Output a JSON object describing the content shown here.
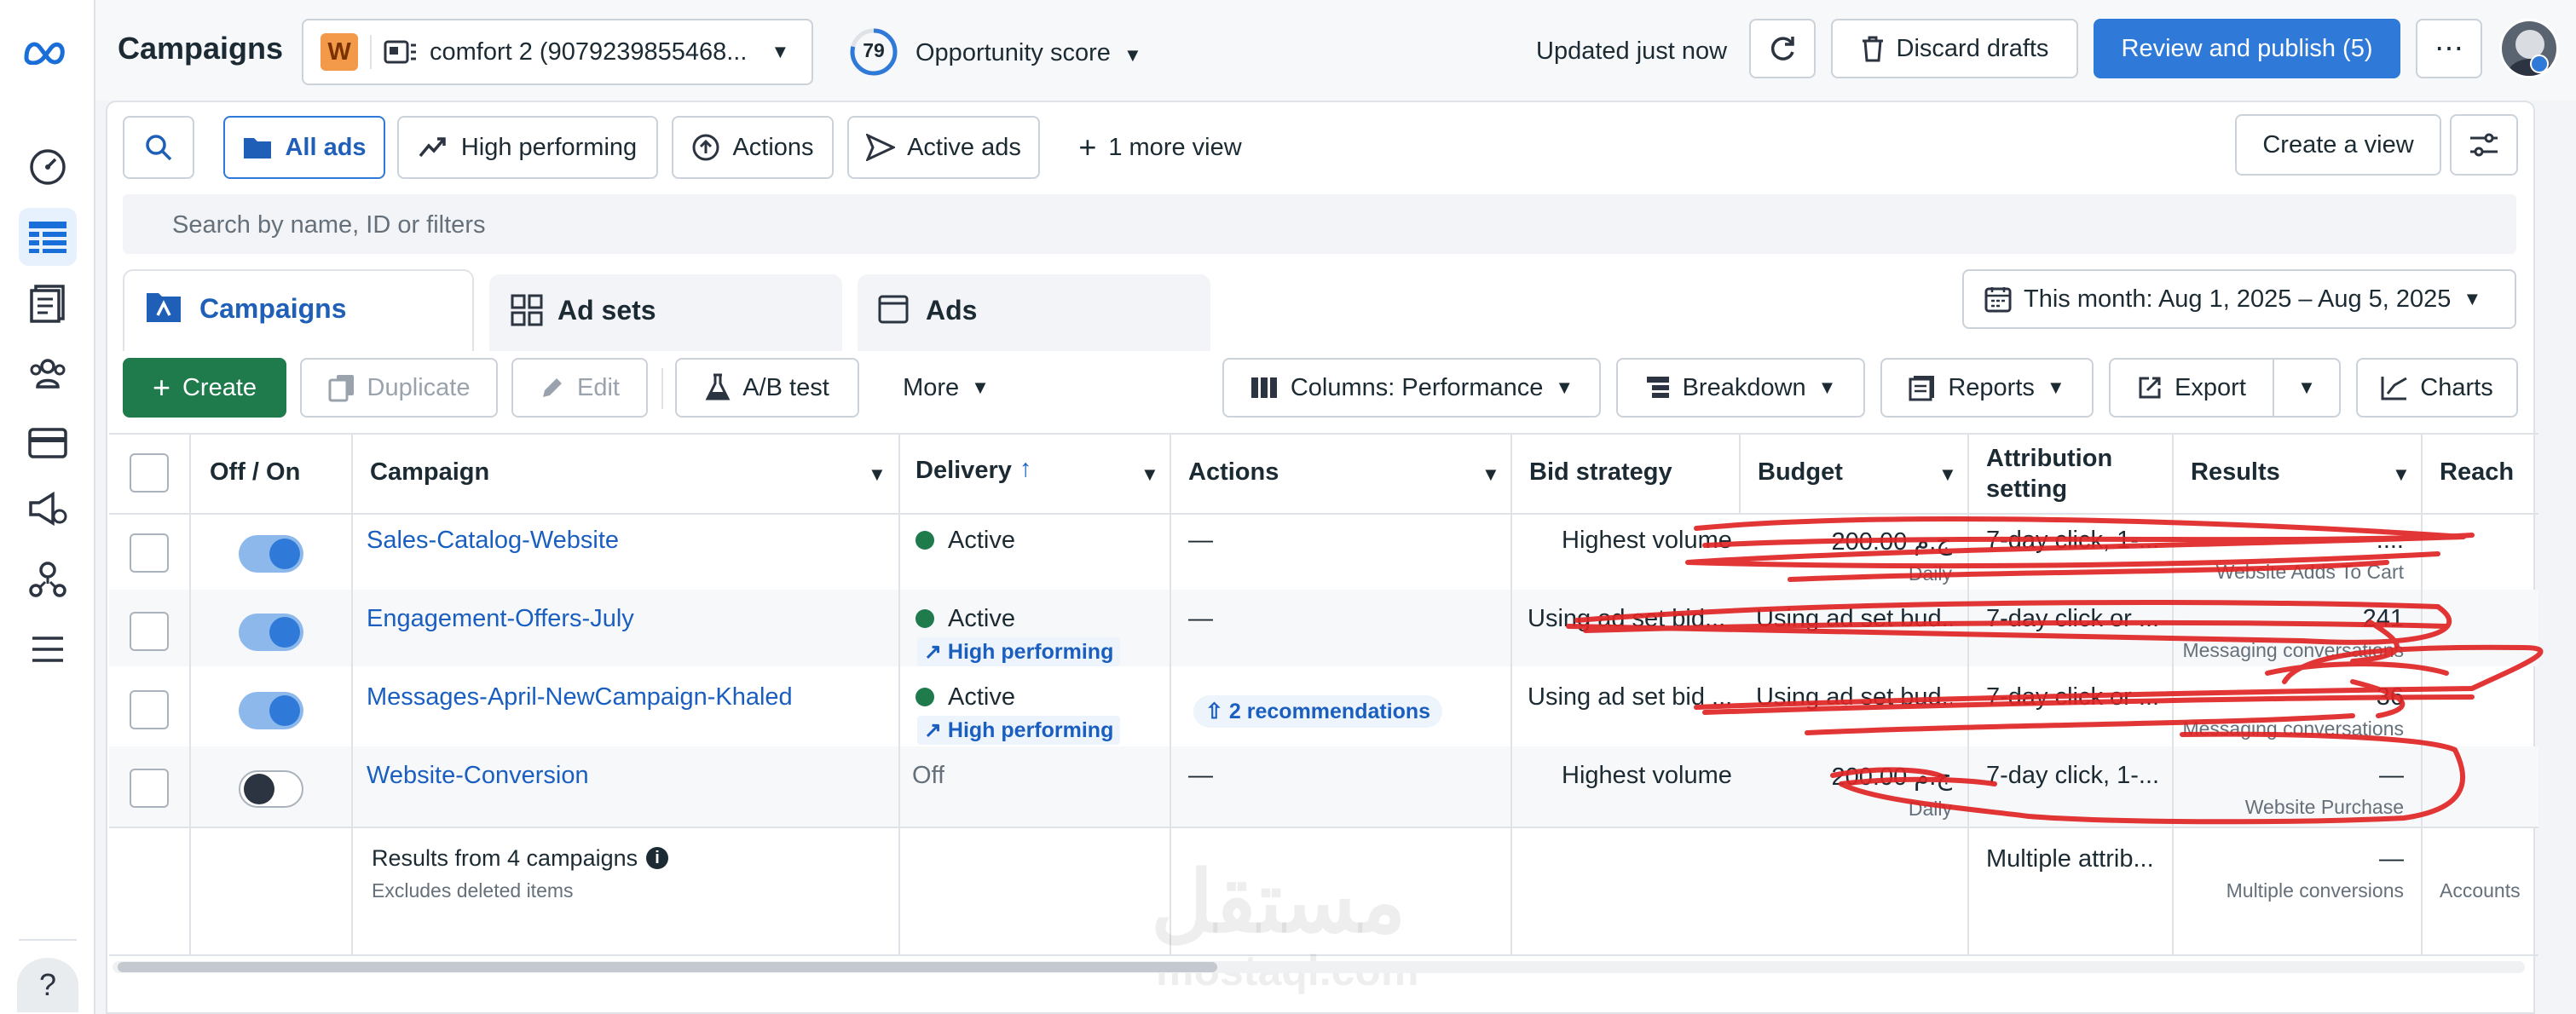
{
  "app": {
    "title": "Campaigns",
    "account": {
      "badge": "W",
      "name": "comfort 2 (9079239855468..."
    },
    "opportunity": {
      "score": "79",
      "label": "Opportunity score"
    },
    "status": "Updated just now",
    "discard_label": "Discard drafts",
    "publish_label": "Review and publish (5)",
    "more_label": "⋯"
  },
  "views": {
    "items": [
      "All ads",
      "High performing",
      "Actions",
      "Active ads"
    ],
    "more_view": "1 more view",
    "create_view": "Create a view",
    "search_placeholder": "Search by name, ID or filters"
  },
  "tabs": [
    {
      "label": "Campaigns"
    },
    {
      "label": "Ad sets"
    },
    {
      "label": "Ads"
    }
  ],
  "date_range": "This month: Aug 1, 2025 – Aug 5, 2025",
  "toolbar": {
    "create": "Create",
    "duplicate": "Duplicate",
    "edit": "Edit",
    "ab_test": "A/B test",
    "more": "More",
    "columns": "Columns: Performance",
    "breakdown": "Breakdown",
    "reports": "Reports",
    "export": "Export",
    "charts": "Charts"
  },
  "table": {
    "headers": {
      "off_on": "Off / On",
      "campaign": "Campaign",
      "delivery": "Delivery",
      "actions": "Actions",
      "bid_strategy": "Bid strategy",
      "budget": "Budget",
      "attribution_1": "Attribution",
      "attribution_2": "setting",
      "results": "Results",
      "reach": "Reach"
    },
    "rows": [
      {
        "on": true,
        "name": "Sales-Catalog-Website",
        "delivery": "Active",
        "tag": "",
        "actions": "—",
        "bid": "Highest volume",
        "budget": "200.00 ج.م",
        "budget_sub": "Daily",
        "attribution": "7-day click, 1-...",
        "results": "....",
        "results_sub": "Website Adds To Cart"
      },
      {
        "on": true,
        "name": "Engagement-Offers-July",
        "delivery": "Active",
        "tag": "High performing",
        "actions": "—",
        "bid": "Using ad set bid...",
        "budget": "Using ad set bud...",
        "budget_sub": "",
        "attribution": "7-day click or ...",
        "results": "241",
        "results_sub": "Messaging conversations"
      },
      {
        "on": true,
        "name": "Messages-April-NewCampaign-Khaled",
        "delivery": "Active",
        "tag": "High performing",
        "actions": "2 recommendations",
        "bid": "Using ad set bid ...",
        "budget": "Using ad set bud...",
        "budget_sub": "",
        "attribution": "7-day click or ...",
        "results": "36",
        "results_sub": "Messaging conversations"
      },
      {
        "on": false,
        "name": "Website-Conversion",
        "delivery": "Off",
        "tag": "",
        "actions": "—",
        "bid": "Highest volume",
        "budget": "200.00 ج.م",
        "budget_sub": "Daily",
        "attribution": "7-day click, 1-...",
        "results": "—",
        "results_sub": "Website Purchase"
      }
    ],
    "summary": {
      "title": "Results from 4 campaigns",
      "sub": "Excludes deleted items",
      "attribution": "Multiple attrib...",
      "results": "—",
      "results_sub": "Multiple conversions",
      "reach_sub": "Accounts"
    }
  },
  "watermark": {
    "arabic": "مستقل",
    "latin": "mostaql.com"
  },
  "help": "?"
}
